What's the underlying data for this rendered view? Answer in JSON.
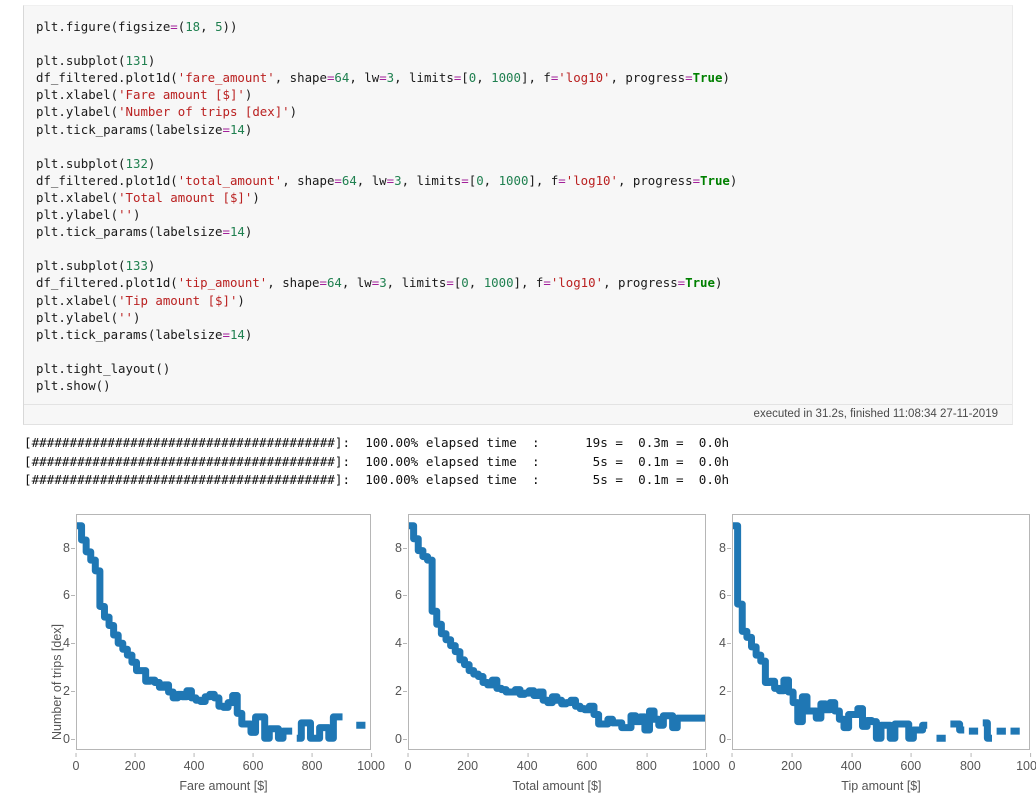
{
  "cell": {
    "code_lines": [
      [
        {
          "t": "plt.figure(figsize",
          "c": "plain"
        },
        {
          "t": "=",
          "c": "op"
        },
        {
          "t": "(",
          "c": "plain"
        },
        {
          "t": "18",
          "c": "num"
        },
        {
          "t": ", ",
          "c": "plain"
        },
        {
          "t": "5",
          "c": "num"
        },
        {
          "t": "))",
          "c": "plain"
        }
      ],
      [],
      [
        {
          "t": "plt.subplot(",
          "c": "plain"
        },
        {
          "t": "131",
          "c": "num"
        },
        {
          "t": ")",
          "c": "plain"
        }
      ],
      [
        {
          "t": "df_filtered.plot1d(",
          "c": "plain"
        },
        {
          "t": "'fare_amount'",
          "c": "str"
        },
        {
          "t": ", shape",
          "c": "plain"
        },
        {
          "t": "=",
          "c": "op"
        },
        {
          "t": "64",
          "c": "num"
        },
        {
          "t": ", lw",
          "c": "plain"
        },
        {
          "t": "=",
          "c": "op"
        },
        {
          "t": "3",
          "c": "num"
        },
        {
          "t": ", limits",
          "c": "plain"
        },
        {
          "t": "=",
          "c": "op"
        },
        {
          "t": "[",
          "c": "plain"
        },
        {
          "t": "0",
          "c": "num"
        },
        {
          "t": ", ",
          "c": "plain"
        },
        {
          "t": "1000",
          "c": "num"
        },
        {
          "t": "], f",
          "c": "plain"
        },
        {
          "t": "=",
          "c": "op"
        },
        {
          "t": "'log10'",
          "c": "str"
        },
        {
          "t": ", progress",
          "c": "plain"
        },
        {
          "t": "=",
          "c": "op"
        },
        {
          "t": "True",
          "c": "kw"
        },
        {
          "t": ")",
          "c": "plain"
        }
      ],
      [
        {
          "t": "plt.xlabel(",
          "c": "plain"
        },
        {
          "t": "'Fare amount [$]'",
          "c": "str"
        },
        {
          "t": ")",
          "c": "plain"
        }
      ],
      [
        {
          "t": "plt.ylabel(",
          "c": "plain"
        },
        {
          "t": "'Number of trips [dex]'",
          "c": "str"
        },
        {
          "t": ")",
          "c": "plain"
        }
      ],
      [
        {
          "t": "plt.tick_params(labelsize",
          "c": "plain"
        },
        {
          "t": "=",
          "c": "op"
        },
        {
          "t": "14",
          "c": "num"
        },
        {
          "t": ")",
          "c": "plain"
        }
      ],
      [],
      [
        {
          "t": "plt.subplot(",
          "c": "plain"
        },
        {
          "t": "132",
          "c": "num"
        },
        {
          "t": ")",
          "c": "plain"
        }
      ],
      [
        {
          "t": "df_filtered.plot1d(",
          "c": "plain"
        },
        {
          "t": "'total_amount'",
          "c": "str"
        },
        {
          "t": ", shape",
          "c": "plain"
        },
        {
          "t": "=",
          "c": "op"
        },
        {
          "t": "64",
          "c": "num"
        },
        {
          "t": ", lw",
          "c": "plain"
        },
        {
          "t": "=",
          "c": "op"
        },
        {
          "t": "3",
          "c": "num"
        },
        {
          "t": ", limits",
          "c": "plain"
        },
        {
          "t": "=",
          "c": "op"
        },
        {
          "t": "[",
          "c": "plain"
        },
        {
          "t": "0",
          "c": "num"
        },
        {
          "t": ", ",
          "c": "plain"
        },
        {
          "t": "1000",
          "c": "num"
        },
        {
          "t": "], f",
          "c": "plain"
        },
        {
          "t": "=",
          "c": "op"
        },
        {
          "t": "'log10'",
          "c": "str"
        },
        {
          "t": ", progress",
          "c": "plain"
        },
        {
          "t": "=",
          "c": "op"
        },
        {
          "t": "True",
          "c": "kw"
        },
        {
          "t": ")",
          "c": "plain"
        }
      ],
      [
        {
          "t": "plt.xlabel(",
          "c": "plain"
        },
        {
          "t": "'Total amount [$]'",
          "c": "str"
        },
        {
          "t": ")",
          "c": "plain"
        }
      ],
      [
        {
          "t": "plt.ylabel(",
          "c": "plain"
        },
        {
          "t": "''",
          "c": "str"
        },
        {
          "t": ")",
          "c": "plain"
        }
      ],
      [
        {
          "t": "plt.tick_params(labelsize",
          "c": "plain"
        },
        {
          "t": "=",
          "c": "op"
        },
        {
          "t": "14",
          "c": "num"
        },
        {
          "t": ")",
          "c": "plain"
        }
      ],
      [],
      [
        {
          "t": "plt.subplot(",
          "c": "plain"
        },
        {
          "t": "133",
          "c": "num"
        },
        {
          "t": ")",
          "c": "plain"
        }
      ],
      [
        {
          "t": "df_filtered.plot1d(",
          "c": "plain"
        },
        {
          "t": "'tip_amount'",
          "c": "str"
        },
        {
          "t": ", shape",
          "c": "plain"
        },
        {
          "t": "=",
          "c": "op"
        },
        {
          "t": "64",
          "c": "num"
        },
        {
          "t": ", lw",
          "c": "plain"
        },
        {
          "t": "=",
          "c": "op"
        },
        {
          "t": "3",
          "c": "num"
        },
        {
          "t": ", limits",
          "c": "plain"
        },
        {
          "t": "=",
          "c": "op"
        },
        {
          "t": "[",
          "c": "plain"
        },
        {
          "t": "0",
          "c": "num"
        },
        {
          "t": ", ",
          "c": "plain"
        },
        {
          "t": "1000",
          "c": "num"
        },
        {
          "t": "], f",
          "c": "plain"
        },
        {
          "t": "=",
          "c": "op"
        },
        {
          "t": "'log10'",
          "c": "str"
        },
        {
          "t": ", progress",
          "c": "plain"
        },
        {
          "t": "=",
          "c": "op"
        },
        {
          "t": "True",
          "c": "kw"
        },
        {
          "t": ")",
          "c": "plain"
        }
      ],
      [
        {
          "t": "plt.xlabel(",
          "c": "plain"
        },
        {
          "t": "'Tip amount [$]'",
          "c": "str"
        },
        {
          "t": ")",
          "c": "plain"
        }
      ],
      [
        {
          "t": "plt.ylabel(",
          "c": "plain"
        },
        {
          "t": "''",
          "c": "str"
        },
        {
          "t": ")",
          "c": "plain"
        }
      ],
      [
        {
          "t": "plt.tick_params(labelsize",
          "c": "plain"
        },
        {
          "t": "=",
          "c": "op"
        },
        {
          "t": "14",
          "c": "num"
        },
        {
          "t": ")",
          "c": "plain"
        }
      ],
      [],
      [
        {
          "t": "plt.tight_layout()",
          "c": "plain"
        }
      ],
      [
        {
          "t": "plt.show()",
          "c": "plain"
        }
      ]
    ],
    "execution_status": "executed in 31.2s, finished 11:08:34 27-11-2019"
  },
  "stdout_lines": [
    "[########################################]:  100.00% elapsed time  :      19s =  0.3m =  0.0h",
    "[########################################]:  100.00% elapsed time  :       5s =  0.1m =  0.0h",
    "[########################################]:  100.00% elapsed time  :       5s =  0.1m =  0.0h"
  ],
  "colors": {
    "line": "#1f77b4",
    "axis": "#b6b6b6",
    "tick_text": "#555555",
    "cell_bg": "#f7f7f7",
    "string": "#ba2121",
    "number": "#208050",
    "keyword": "#008000",
    "operator": "#a2209a"
  },
  "chart_data": [
    {
      "type": "line",
      "drawstyle": "steps",
      "title": "",
      "xlabel": "Fare amount [$]",
      "ylabel": "Number of trips [dex]",
      "xlim": [
        0,
        1000
      ],
      "ylim": [
        -0.45,
        9.4
      ],
      "grid": false,
      "legend": null,
      "xticks": [
        0,
        200,
        400,
        600,
        800,
        1000
      ],
      "yticks": [
        0,
        2,
        4,
        6,
        8
      ],
      "bin_edges_step": 15.625,
      "n_bins": 64,
      "x": [
        7.8,
        23.4,
        39.1,
        54.7,
        70.3,
        85.9,
        101.6,
        117.2,
        132.8,
        148.4,
        164.1,
        179.7,
        195.3,
        210.9,
        226.6,
        242.2,
        257.8,
        273.4,
        289.1,
        304.7,
        320.3,
        335.9,
        351.6,
        367.2,
        382.8,
        398.4,
        414.1,
        429.7,
        445.3,
        460.9,
        476.6,
        492.2,
        507.8,
        523.4,
        539.1,
        554.7,
        570.3,
        585.9,
        601.6,
        617.2,
        632.8,
        648.4,
        664.1,
        679.7,
        695.3,
        710.9,
        726.6,
        742.2,
        757.8,
        773.4,
        789.1,
        804.7,
        820.3,
        835.9,
        851.6,
        867.2,
        882.8,
        898.4,
        914.1,
        929.7,
        945.3,
        960.9,
        976.6,
        992.2
      ],
      "y": [
        8.95,
        8.35,
        7.85,
        7.5,
        7.05,
        5.55,
        5.1,
        4.75,
        4.35,
        4.0,
        3.75,
        3.5,
        3.2,
        2.85,
        2.85,
        2.4,
        2.45,
        2.35,
        2.15,
        2.25,
        1.95,
        1.7,
        1.85,
        1.75,
        2.0,
        1.7,
        1.6,
        1.55,
        1.75,
        1.85,
        1.7,
        1.35,
        1.3,
        1.5,
        1.8,
        1.05,
        0.6,
        0.6,
        0.25,
        0.9,
        0.9,
        0.0,
        0.4,
        0.4,
        0.0,
        0.3,
        0.3,
        null,
        0.0,
        0.65,
        0.65,
        0.0,
        0.0,
        0.45,
        0.45,
        0.0,
        0.9,
        0.9,
        null,
        null,
        null,
        0.55,
        0.55,
        null
      ]
    },
    {
      "type": "line",
      "drawstyle": "steps",
      "title": "",
      "xlabel": "Total amount [$]",
      "ylabel": "",
      "xlim": [
        0,
        1000
      ],
      "ylim": [
        -0.45,
        9.4
      ],
      "grid": false,
      "legend": null,
      "xticks": [
        0,
        200,
        400,
        600,
        800,
        1000
      ],
      "yticks": [
        0,
        2,
        4,
        6,
        8
      ],
      "bin_edges_step": 15.625,
      "n_bins": 64,
      "x": [
        7.8,
        23.4,
        39.1,
        54.7,
        70.3,
        85.9,
        101.6,
        117.2,
        132.8,
        148.4,
        164.1,
        179.7,
        195.3,
        210.9,
        226.6,
        242.2,
        257.8,
        273.4,
        289.1,
        304.7,
        320.3,
        335.9,
        351.6,
        367.2,
        382.8,
        398.4,
        414.1,
        429.7,
        445.3,
        460.9,
        476.6,
        492.2,
        507.8,
        523.4,
        539.1,
        554.7,
        570.3,
        585.9,
        601.6,
        617.2,
        632.8,
        648.4,
        664.1,
        679.7,
        695.3,
        710.9,
        726.6,
        742.2,
        757.8,
        773.4,
        789.1,
        804.7,
        820.3,
        835.9,
        851.6,
        867.2,
        882.8,
        898.4,
        914.1,
        929.7,
        945.3,
        960.9,
        976.6,
        992.2
      ],
      "y": [
        8.95,
        8.4,
        7.9,
        7.65,
        7.5,
        5.35,
        4.8,
        4.4,
        4.15,
        3.9,
        3.65,
        3.3,
        3.1,
        2.85,
        2.7,
        2.6,
        2.35,
        2.25,
        2.45,
        2.1,
        2.05,
        1.95,
        1.95,
        2.05,
        1.85,
        1.9,
        2.0,
        1.8,
        1.95,
        1.6,
        1.5,
        1.75,
        1.6,
        1.45,
        1.5,
        1.6,
        1.35,
        1.25,
        1.2,
        1.35,
        1.0,
        0.6,
        0.6,
        0.8,
        0.65,
        0.65,
        0.45,
        0.45,
        0.95,
        0.7,
        0.9,
        0.35,
        1.15,
        0.8,
        0.55,
        0.95,
        0.95,
        0.45,
        0.85,
        0.85,
        0.85,
        0.85,
        0.85,
        0.85
      ]
    },
    {
      "type": "line",
      "drawstyle": "steps",
      "title": "",
      "xlabel": "Tip amount [$]",
      "ylabel": "",
      "xlim": [
        0,
        1000
      ],
      "ylim": [
        -0.45,
        9.4
      ],
      "grid": false,
      "legend": null,
      "xticks": [
        0,
        200,
        400,
        600,
        800,
        1000
      ],
      "yticks": [
        0,
        2,
        4,
        6,
        8
      ],
      "bin_edges_step": 15.625,
      "n_bins": 64,
      "x": [
        7.8,
        23.4,
        39.1,
        54.7,
        70.3,
        85.9,
        101.6,
        117.2,
        132.8,
        148.4,
        164.1,
        179.7,
        195.3,
        210.9,
        226.6,
        242.2,
        257.8,
        273.4,
        289.1,
        304.7,
        320.3,
        335.9,
        351.6,
        367.2,
        382.8,
        398.4,
        414.1,
        429.7,
        445.3,
        460.9,
        476.6,
        492.2,
        507.8,
        523.4,
        539.1,
        554.7,
        570.3,
        585.9,
        601.6,
        617.2,
        632.8,
        648.4,
        664.1,
        679.7,
        695.3,
        710.9,
        726.6,
        742.2,
        757.8,
        773.4,
        789.1,
        804.7,
        820.3,
        835.9,
        851.6,
        867.2,
        882.8,
        898.4,
        914.1,
        929.7,
        945.3,
        960.9,
        976.6,
        992.2
      ],
      "y": [
        8.95,
        5.65,
        4.5,
        4.25,
        3.85,
        3.5,
        3.25,
        2.35,
        2.4,
        2.1,
        2.0,
        2.45,
        1.95,
        1.5,
        0.7,
        1.75,
        1.15,
        1.15,
        0.85,
        1.45,
        1.2,
        1.5,
        1.15,
        0.8,
        0.45,
        1.0,
        1.0,
        1.25,
        0.5,
        0.75,
        0.7,
        0.0,
        0.55,
        0.55,
        0.0,
        0.6,
        0.6,
        0.6,
        0.0,
        0.35,
        0.35,
        0.55,
        null,
        null,
        0.0,
        0.0,
        null,
        0.6,
        0.6,
        0.35,
        null,
        0.3,
        0.3,
        null,
        0.65,
        0.0,
        null,
        0.3,
        0.3,
        null,
        0.3,
        0.3,
        null,
        null
      ]
    }
  ]
}
